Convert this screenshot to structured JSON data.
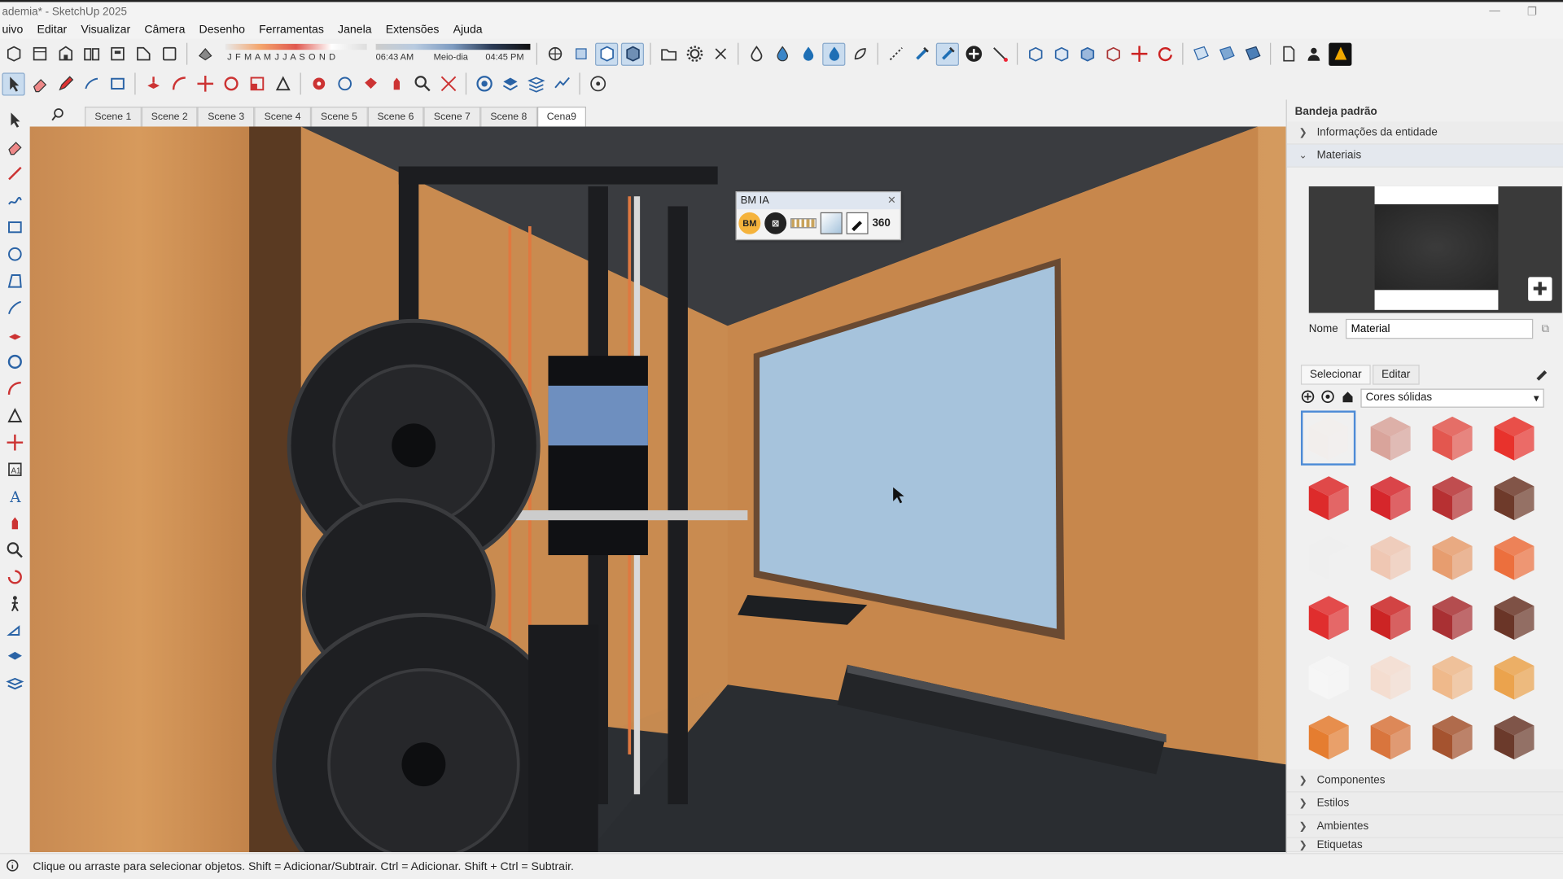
{
  "window": {
    "title": "ademia* - SketchUp 2025"
  },
  "menu": [
    "uivo",
    "Editar",
    "Visualizar",
    "Câmera",
    "Desenho",
    "Ferramentas",
    "Janela",
    "Extensões",
    "Ajuda"
  ],
  "shadow": {
    "months": "J F M A M J J A S O N D",
    "time_start": "06:43 AM",
    "time_mid": "Meio-dia",
    "time_end": "04:45 PM"
  },
  "scenes": [
    "Scene 1",
    "Scene 2",
    "Scene 3",
    "Scene 4",
    "Scene 5",
    "Scene 6",
    "Scene 7",
    "Scene 8",
    "Cena9"
  ],
  "active_scene": "Cena9",
  "float_panel": {
    "title": "BM IA",
    "btn_bm": "BM",
    "btn_360": "360"
  },
  "tray": {
    "title": "Bandeja padrão",
    "entity_info": "Informações da entidade",
    "materials": "Materiais",
    "name_label": "Nome",
    "name_value": "Material",
    "tab_select": "Selecionar",
    "tab_edit": "Editar",
    "library": "Cores sólidas",
    "components": "Componentes",
    "styles": "Estilos",
    "environments": "Ambientes",
    "tags": "Etiquetas"
  },
  "swatches": [
    "#f2eeec",
    "#d9a49b",
    "#e3574f",
    "#e8322c",
    "#dd2b2b",
    "#d6262b",
    "#b73032",
    "#6e3a2a",
    "#efefef",
    "#efc7b3",
    "#e79d6f",
    "#ec6f3d",
    "#e02e2e",
    "#cc2424",
    "#a93033",
    "#6a3527",
    "#f6f6f6",
    "#f4ddd0",
    "#efb98b",
    "#eba34d",
    "#e57d30",
    "#d9753d",
    "#a5532f",
    "#6b3a2b"
  ],
  "status": {
    "text": "Clique ou arraste para selecionar objetos. Shift = Adicionar/Subtrair. Ctrl = Adicionar. Shift + Ctrl = Subtrair."
  },
  "colors": {
    "accent": "#4d8bd6",
    "wood": "#c98a4f",
    "floor": "#2a2d31",
    "board": "#a6c3dc"
  }
}
